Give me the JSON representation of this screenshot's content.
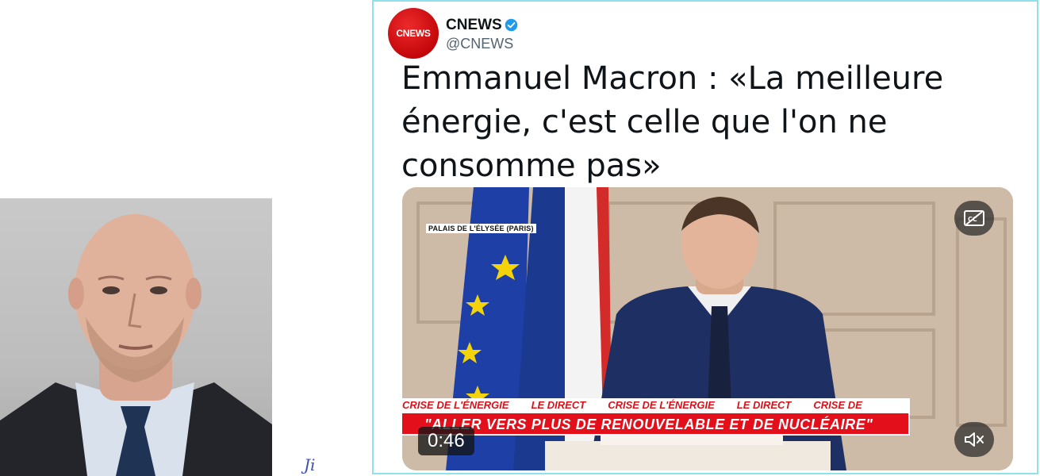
{
  "tweet": {
    "account_name": "CNEWS",
    "handle": "@CNEWS",
    "avatar_logo_text": "CNEWS",
    "verified": true,
    "text": "Emmanuel Macron : «La meilleure énergie, c'est celle que l'on ne consomme pas»"
  },
  "video": {
    "location_tag": "PALAIS DE L'ÉLYSÉE (PARIS)",
    "ticker_items": [
      "CRISE DE L'ÉNERGIE",
      "LE DIRECT",
      "CRISE DE L'ÉNERGIE",
      "LE DIRECT",
      "CRISE DE"
    ],
    "headline": "\"ALLER VERS PLUS DE RENOUVELABLE ET DE NUCLÉAIRE\"",
    "timestamp": "0:46",
    "cc_icon": "closed-captions-icon",
    "mute_icon": "speaker-muted-icon"
  },
  "signature": "Ji",
  "colors": {
    "cnews_red": "#c4070b",
    "verified_blue": "#1d9bf0",
    "ticker_red": "#e3101b",
    "card_border": "#8fe1ea"
  }
}
